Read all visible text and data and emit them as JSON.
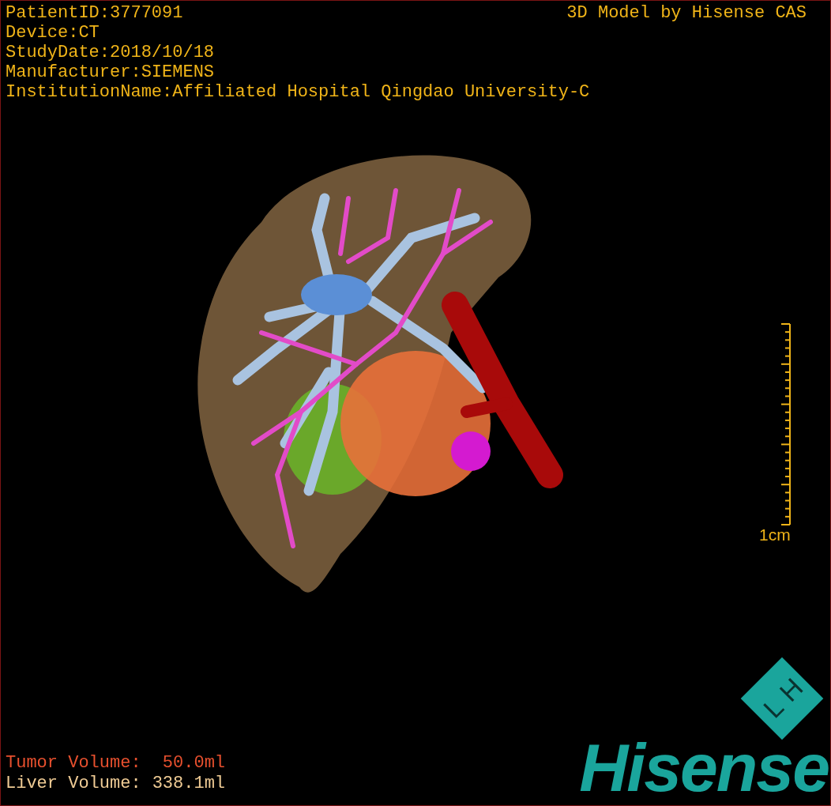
{
  "study_info": [
    "PatientID:3777091",
    "Device:CT",
    "StudyDate:2018/10/18",
    "Manufacturer:SIEMENS",
    "InstitutionName:Affiliated Hospital Qingdao University-C"
  ],
  "title": "3D Model by Hisense CAS",
  "scale": {
    "label": "1cm"
  },
  "volumes": [
    {
      "label": "Tumor Volume:",
      "value": "50.0ml",
      "color": "#e8502e"
    },
    {
      "label": "Liver Volume:",
      "value": "338.1ml",
      "color": "#f0cc95"
    }
  ],
  "logo": {
    "emblem_letters": [
      "H",
      "L"
    ],
    "wordmark": "Hisense"
  }
}
